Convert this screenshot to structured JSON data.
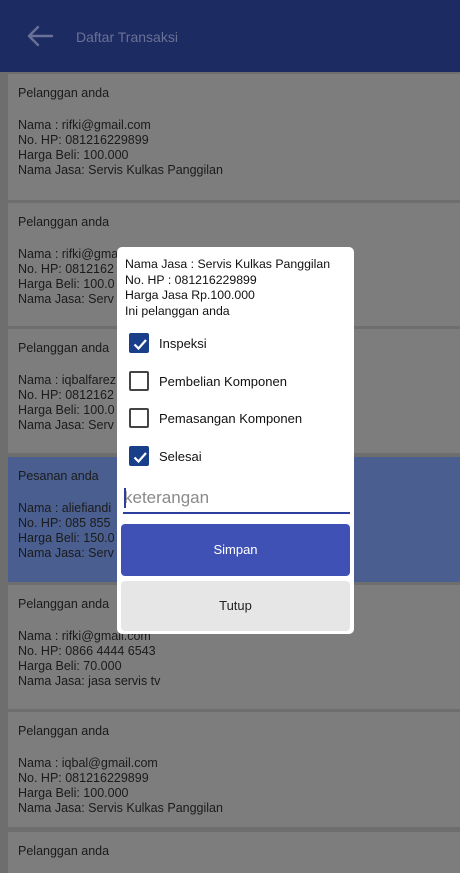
{
  "appbar": {
    "title": "Daftar Transaksi",
    "back_icon": "arrow-left-icon"
  },
  "cards": [
    {
      "head": "Pelanggan anda",
      "lines": [
        "Nama : rifki@gmail.com",
        "No. HP: 081216229899",
        "Harga Beli: 100.000",
        "Nama Jasa: Servis Kulkas Panggilan"
      ]
    },
    {
      "head": "Pelanggan anda",
      "lines": [
        "Nama : rifki@gmail",
        "No. HP: 0812162",
        "Harga Beli: 100.0",
        "Nama Jasa: Serv"
      ]
    },
    {
      "head": "Pelanggan anda",
      "lines": [
        "Nama : iqbalfarez",
        "No. HP: 0812162",
        "Harga Beli: 100.0",
        "Nama Jasa: Serv"
      ]
    },
    {
      "head": "Pesanan anda",
      "lines": [
        "Nama : aliefiandi",
        "No. HP: 085 855",
        "Harga Beli: 150.0",
        "Nama Jasa: Serv"
      ]
    },
    {
      "head": "Pelanggan anda",
      "lines": [
        "Nama : rifki@gmail.com",
        "No. HP: 0866 4444 6543",
        "Harga Beli: 70.000",
        "Nama Jasa: jasa servis tv"
      ]
    },
    {
      "head": "Pelanggan anda",
      "lines": [
        "Nama : iqbal@gmail.com",
        "No. HP: 081216229899",
        "Harga Beli: 100.000",
        "Nama Jasa: Servis Kulkas Panggilan"
      ]
    },
    {
      "head": "Pelanggan anda",
      "lines": []
    }
  ],
  "dialog": {
    "info": [
      "Nama Jasa : Servis Kulkas Panggilan",
      "No. HP : 081216229899",
      "Harga Jasa Rp.100.000",
      "Ini pelanggan anda"
    ],
    "checkboxes": [
      {
        "label": "Inspeksi",
        "checked": true
      },
      {
        "label": "Pembelian Komponen",
        "checked": false
      },
      {
        "label": "Pemasangan Komponen",
        "checked": false
      },
      {
        "label": "Selesai",
        "checked": true
      }
    ],
    "input_placeholder": "keterangan",
    "primary_button": "Simpan",
    "secondary_button": "Tutup"
  },
  "colors": {
    "appbar": "#1d2b63",
    "primary": "#3f51b5",
    "checked": "#1a3f8a"
  }
}
